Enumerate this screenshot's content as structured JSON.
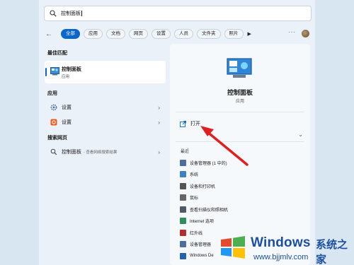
{
  "search": {
    "value": "控制面板"
  },
  "filters": {
    "chips": [
      "全部",
      "应用",
      "文档",
      "网页",
      "设置",
      "人员",
      "文件夹",
      "照片"
    ],
    "more": "···"
  },
  "left": {
    "best_match_heading": "最佳匹配",
    "best_match": {
      "title": "控制面板",
      "subtitle": "应用"
    },
    "apps_heading": "应用",
    "apps": [
      {
        "label": "设置",
        "icon": "gear-icon"
      },
      {
        "label": "设置",
        "icon": "settings-app-icon"
      }
    ],
    "web_heading": "搜索网页",
    "web": {
      "label": "控制面板",
      "sub": "- 查看网络搜索结果"
    }
  },
  "detail": {
    "title": "控制面板",
    "subtitle": "应用",
    "open_label": "打开",
    "recent_heading": "最近",
    "recent": [
      {
        "label": "设备管理器 (1 中的)",
        "color": "#4a6f9c"
      },
      {
        "label": "系统",
        "color": "#3f7fc4"
      },
      {
        "label": "设备和打印机",
        "color": "#555555"
      },
      {
        "label": "鼠标",
        "color": "#666666"
      },
      {
        "label": "查看扫描仪和照相机",
        "color": "#505a64"
      },
      {
        "label": "Internet 选项",
        "color": "#2f8f5a"
      },
      {
        "label": "红外线",
        "color": "#b03030"
      },
      {
        "label": "设备管理器",
        "color": "#4a6f9c"
      },
      {
        "label": "Windows De",
        "color": "#2563b0"
      }
    ]
  },
  "watermark": {
    "brand": "Windows",
    "brand_cn": "系统之家",
    "url": "www.bjjmlv.com"
  },
  "colors": {
    "accent": "#0a67c9",
    "annotation": "#e02020"
  }
}
